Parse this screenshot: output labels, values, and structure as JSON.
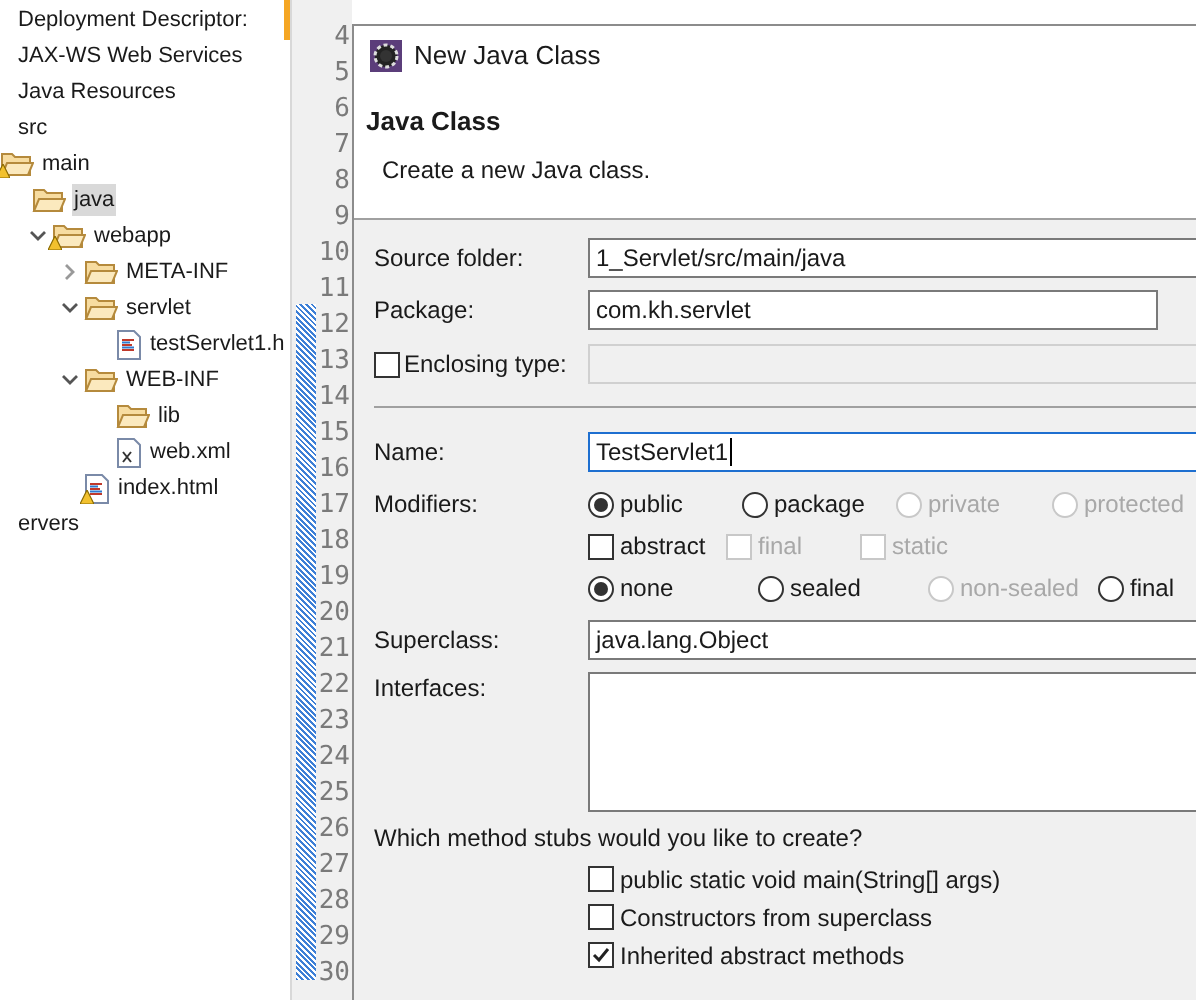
{
  "project_tree": [
    {
      "label": "Deployment Descriptor:",
      "kind": "plain",
      "selected": false
    },
    {
      "label": "JAX-WS Web Services",
      "kind": "plain",
      "selected": false
    },
    {
      "label": "Java Resources",
      "kind": "plain",
      "selected": false
    },
    {
      "label": "src",
      "kind": "plain",
      "selected": false,
      "children": [
        {
          "label": "main",
          "kind": "folder",
          "warning": true,
          "selected": false,
          "children": [
            {
              "label": "java",
              "kind": "folder",
              "selected": true
            },
            {
              "label": "webapp",
              "kind": "folder",
              "warning": true,
              "expanded": true,
              "selected": false,
              "children": [
                {
                  "label": "META-INF",
                  "kind": "folder",
                  "expanded": false,
                  "selected": false
                },
                {
                  "label": "servlet",
                  "kind": "folder",
                  "expanded": true,
                  "selected": false,
                  "children": [
                    {
                      "label": "testServlet1.h",
                      "kind": "html-file",
                      "selected": false
                    }
                  ]
                },
                {
                  "label": "WEB-INF",
                  "kind": "folder",
                  "expanded": true,
                  "selected": false,
                  "children": [
                    {
                      "label": "lib",
                      "kind": "folder",
                      "selected": false
                    },
                    {
                      "label": "web.xml",
                      "kind": "xml-file",
                      "selected": false
                    }
                  ]
                },
                {
                  "label": "index.html",
                  "kind": "html-file",
                  "warning": true,
                  "selected": false
                }
              ]
            }
          ]
        }
      ]
    },
    {
      "label": "ervers",
      "kind": "plain",
      "selected": false
    }
  ],
  "editor": {
    "line_numbers": [
      "4",
      "5",
      "6",
      "7",
      "8",
      "9",
      "10",
      "11",
      "12",
      "13",
      "14",
      "15",
      "16",
      "17",
      "18",
      "19",
      "20",
      "21",
      "22",
      "23",
      "24",
      "25",
      "26",
      "27",
      "28",
      "29",
      "30"
    ]
  },
  "dialog": {
    "title": "New Java Class",
    "header": {
      "title": "Java Class",
      "description": "Create a new Java class."
    },
    "source_folder": {
      "label": "Source folder:",
      "value": "1_Servlet/src/main/java"
    },
    "package": {
      "label": "Package:",
      "value": "com.kh.servlet"
    },
    "enclosing_type": {
      "label": "Enclosing type:",
      "checked": false,
      "disabled": true
    },
    "name": {
      "label": "Name:",
      "value": "TestServlet1",
      "focused": true
    },
    "modifiers": {
      "label": "Modifiers:",
      "rows": [
        [
          {
            "label": "public",
            "kind": "radio",
            "selected": true,
            "disabled": false
          },
          {
            "label": "package",
            "kind": "radio",
            "selected": false,
            "disabled": false
          },
          {
            "label": "private",
            "kind": "radio",
            "selected": false,
            "disabled": true
          },
          {
            "label": "protected",
            "kind": "radio",
            "selected": false,
            "disabled": true
          }
        ],
        [
          {
            "label": "abstract",
            "kind": "checkbox",
            "checked": false,
            "disabled": false
          },
          {
            "label": "final",
            "kind": "checkbox",
            "checked": false,
            "disabled": true
          },
          {
            "label": "static",
            "kind": "checkbox",
            "checked": false,
            "disabled": true
          }
        ],
        [
          {
            "label": "none",
            "kind": "radio",
            "selected": true,
            "disabled": false
          },
          {
            "label": "sealed",
            "kind": "radio",
            "selected": false,
            "disabled": false
          },
          {
            "label": "non-sealed",
            "kind": "radio",
            "selected": false,
            "disabled": true
          },
          {
            "label": "final",
            "kind": "radio",
            "selected": false,
            "disabled": false
          }
        ]
      ]
    },
    "superclass": {
      "label": "Superclass:",
      "value": "java.lang.Object"
    },
    "interfaces": {
      "label": "Interfaces:"
    },
    "stubs": {
      "question": "Which method stubs would you like to create?",
      "options": [
        {
          "label": "public static void main(String[] args)",
          "checked": false
        },
        {
          "label": "Constructors from superclass",
          "checked": false
        },
        {
          "label": "Inherited abstract methods",
          "checked": true
        }
      ]
    }
  }
}
